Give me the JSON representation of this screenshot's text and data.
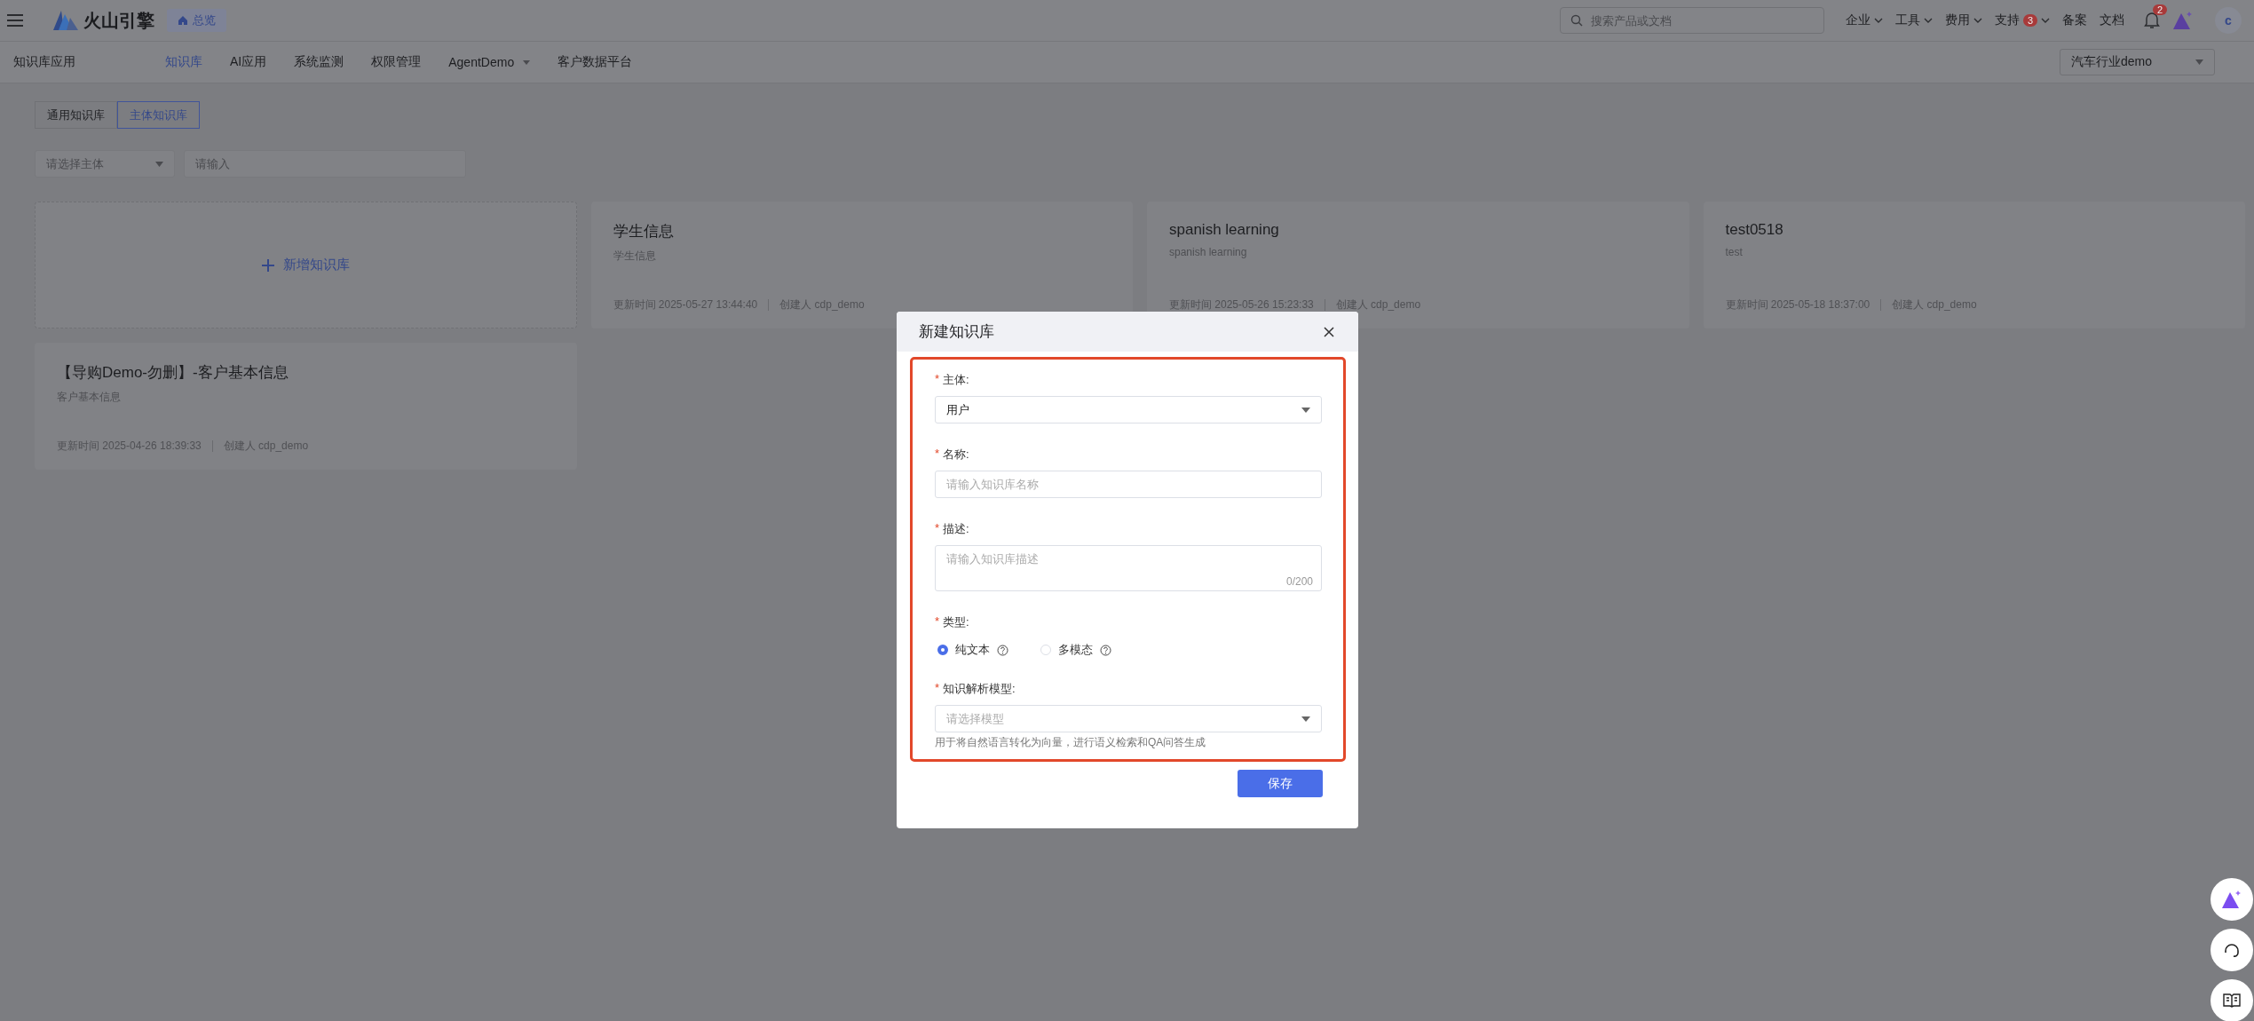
{
  "topbar": {
    "brand": "火山引擎",
    "home_tab": "总览",
    "search": {
      "placeholder": "搜索产品或文档"
    },
    "menus": [
      {
        "label": "企业",
        "kind": "dropdown"
      },
      {
        "label": "工具",
        "kind": "dropdown"
      },
      {
        "label": "费用",
        "kind": "dropdown"
      },
      {
        "label": "支持",
        "kind": "dropdown",
        "badge": "3"
      },
      {
        "label": "备案",
        "kind": "link"
      },
      {
        "label": "文档",
        "kind": "link"
      }
    ],
    "notification_badge": "2",
    "avatar": "c"
  },
  "app_nav": {
    "title": "知识库应用",
    "items": [
      {
        "label": "知识库",
        "selected": true,
        "kind": "link"
      },
      {
        "label": "AI应用",
        "selected": false,
        "kind": "link"
      },
      {
        "label": "系统监测",
        "selected": false,
        "kind": "link"
      },
      {
        "label": "权限管理",
        "selected": false,
        "kind": "link"
      },
      {
        "label": "AgentDemo",
        "selected": false,
        "kind": "dropdown"
      },
      {
        "label": "客户数据平台",
        "selected": false,
        "kind": "link"
      }
    ],
    "workspace": "汽车行业demo"
  },
  "tabs": [
    {
      "label": "通用知识库",
      "selected": false
    },
    {
      "label": "主体知识库",
      "selected": true
    }
  ],
  "filters": {
    "subject": {
      "placeholder": "请选择主体"
    },
    "search": {
      "placeholder": "请输入"
    }
  },
  "add_card": {
    "label": "新增知识库"
  },
  "cards": [
    {
      "title": "学生信息",
      "description": "学生信息",
      "updated": "更新时间 2025-05-27 13:44:40",
      "creator": "创建人 cdp_demo"
    },
    {
      "title": "spanish learning",
      "description": "spanish learning",
      "updated": "更新时间 2025-05-26 15:23:33",
      "creator": "创建人 cdp_demo"
    },
    {
      "title": "test0518",
      "description": "test",
      "updated": "更新时间 2025-05-18 18:37:00",
      "creator": "创建人 cdp_demo"
    },
    {
      "title": "【导购Demo-勿删】-客户基本信息",
      "description": "客户基本信息",
      "updated": "更新时间 2025-04-26 18:39:33",
      "creator": "创建人 cdp_demo"
    }
  ],
  "dialog": {
    "title": "新建知识库",
    "highlighted": true,
    "fields": [
      {
        "kind": "select",
        "label": "主体:",
        "required_mark": "*",
        "value": "用户"
      },
      {
        "kind": "text",
        "label": "名称:",
        "required_mark": "*",
        "placeholder": "请输入知识库名称"
      },
      {
        "kind": "textarea",
        "label": "描述:",
        "required_mark": "*",
        "placeholder": "请输入知识库描述",
        "counter": "0/200"
      },
      {
        "kind": "radio",
        "label": "类型:",
        "required_mark": "*",
        "options": [
          {
            "label": "纯文本",
            "selected": true
          },
          {
            "label": "多模态",
            "selected": false
          }
        ]
      },
      {
        "kind": "select",
        "label": "知识解析模型:",
        "required_mark": "*",
        "placeholder": "请选择模型",
        "hint": "用于将自然语言转化为向量，进行语义检索和QA问答生成"
      }
    ],
    "save_button": "保存"
  }
}
